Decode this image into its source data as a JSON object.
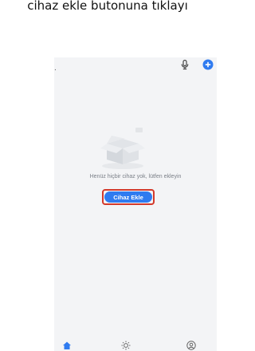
{
  "caption": "cihaz ekle butonuna tıklayı",
  "status": {
    "dot": "."
  },
  "header": {
    "icons": [
      "mic-icon",
      "add-circle-icon"
    ]
  },
  "empty_state": {
    "illustration": "empty-box-illustration",
    "message": "Henüz hiçbir cihaz yok, lütfen ekleyin"
  },
  "add_device": {
    "label": "Cihaz Ekle",
    "highlight_color": "#d33a2c",
    "button_color": "#2f7bf0"
  },
  "tabs": [
    {
      "icon": "home-icon",
      "active": true
    },
    {
      "icon": "scenes-sun-icon",
      "active": false
    },
    {
      "icon": "profile-icon",
      "active": false
    }
  ],
  "colors": {
    "accent": "#2f7bf0",
    "background": "#f3f4f6"
  }
}
